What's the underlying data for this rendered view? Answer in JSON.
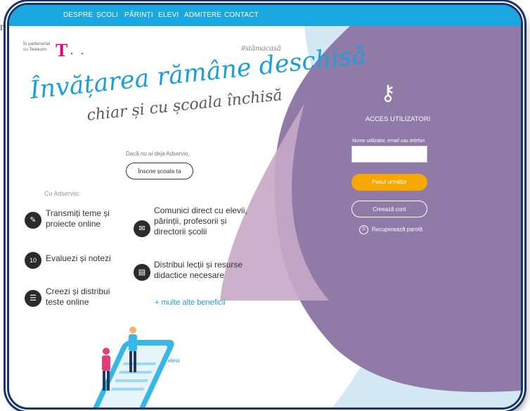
{
  "corner_text": "ro",
  "nav": {
    "items": [
      "DESPRE",
      "ȘCOLI",
      "PĂRINȚI",
      "ELEVI",
      "ADMITERE",
      "CONTACT"
    ]
  },
  "partner": {
    "text": "În parteneriat cu Telekom:",
    "logo_letter": "T",
    "logo_dots": "· ·"
  },
  "hashtag": "#stămacasă",
  "hero": {
    "line1": "Învățarea rămâne deschisă",
    "line2": "chiar și cu școala închisă"
  },
  "register": {
    "hint": "Dacă nu ai deja Adservio,",
    "button": "Înscrie școala ta"
  },
  "features": {
    "heading": "Cu Adservio:",
    "items": [
      {
        "icon": "pencil-note-icon",
        "glyph": "✎",
        "text": "Transmiți teme și proiecte online"
      },
      {
        "icon": "envelope-icon",
        "glyph": "✉",
        "text": "Comunici direct cu elevii, părinții, profesorii și directorii școlii"
      },
      {
        "icon": "grade-ten-icon",
        "glyph": "10",
        "text": "Evaluezi și notezi"
      },
      {
        "icon": "document-icon",
        "glyph": "▤",
        "text": "Distribui lecții și resurse didactice necesare"
      },
      {
        "icon": "test-list-icon",
        "glyph": "☰",
        "text": "Creezi și distribui teste online"
      }
    ],
    "more": "+ multe alte beneficii"
  },
  "login": {
    "title": "ACCES UTILIZATORI",
    "field_label": "Nume utilizator, email sau telefon",
    "field_value": "",
    "next_button": "Pasul următor",
    "create_button": "Creează cont",
    "recover": "Recuperează parolă"
  },
  "illustration": {
    "phone_label": "elevi"
  },
  "colors": {
    "nav": "#1aa6e0",
    "accent": "#f7a800",
    "purple": "#8f7aa8",
    "brand_magenta": "#e20074"
  }
}
